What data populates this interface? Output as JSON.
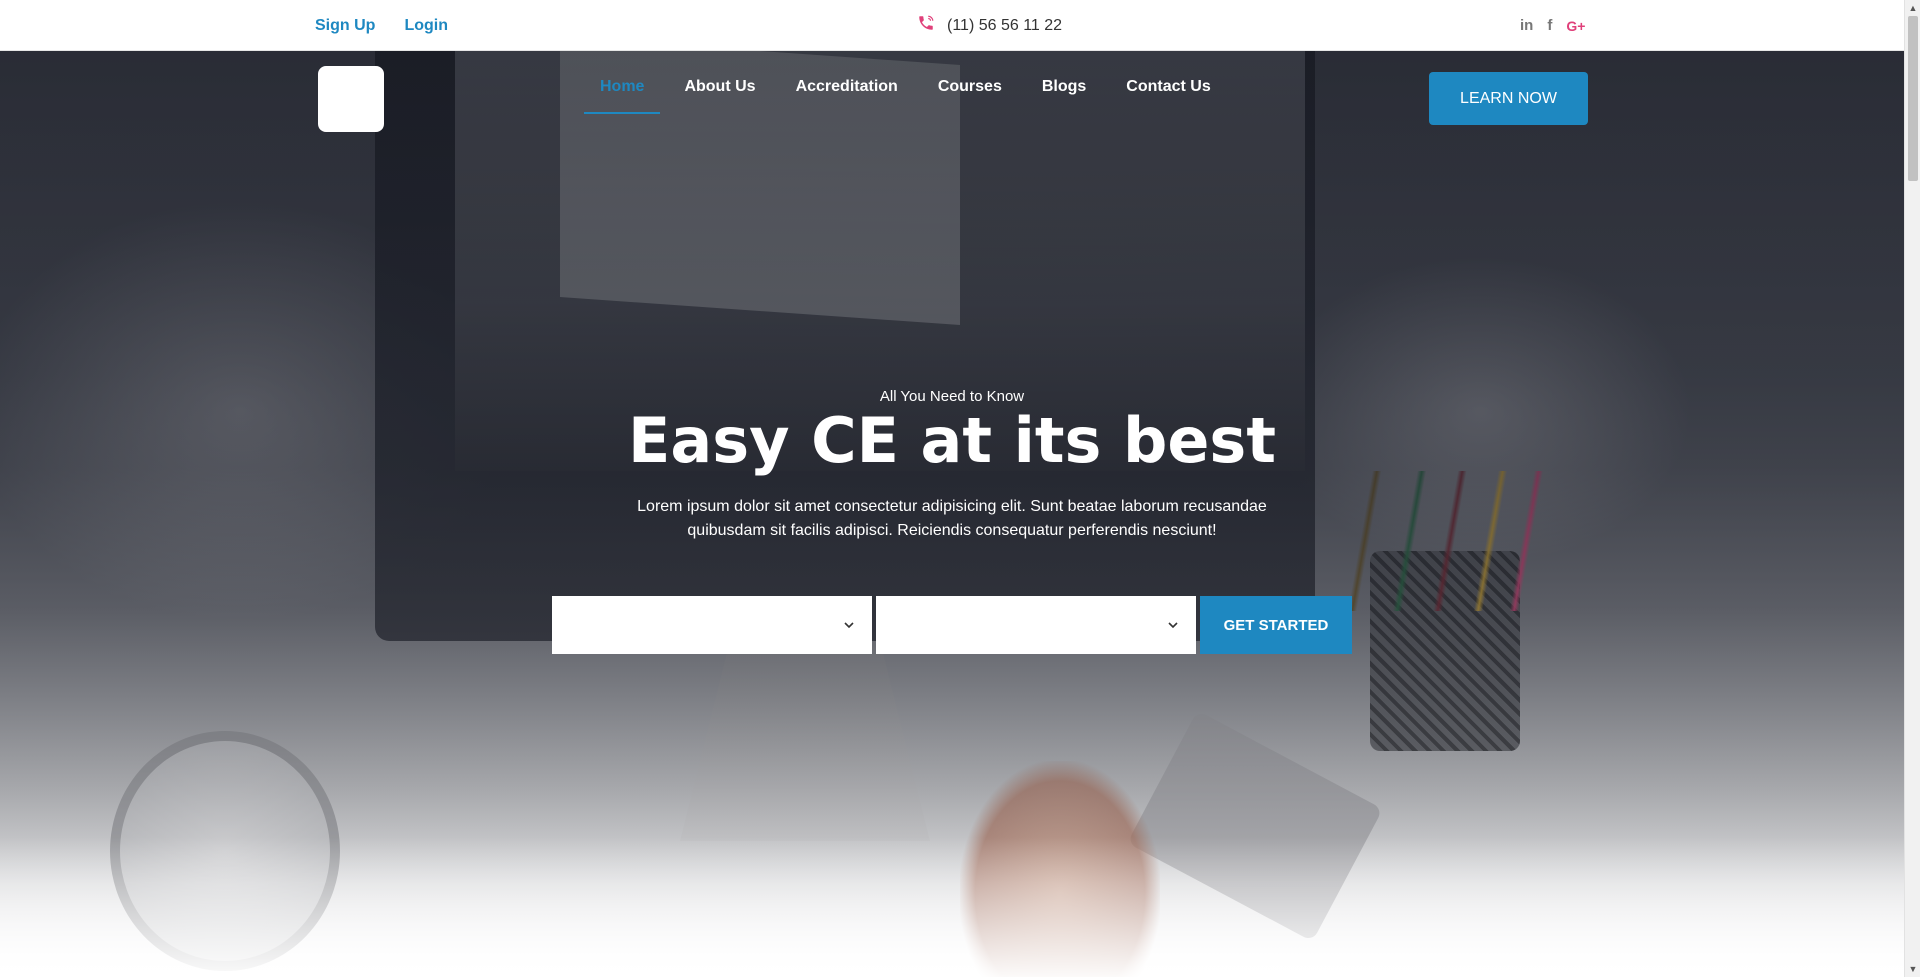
{
  "topbar": {
    "signup_label": "Sign Up",
    "login_label": "Login",
    "phone": "(11) 56 56 11 22",
    "phone_icon": "phone-icon",
    "social_icons": [
      "linkedin-icon",
      "facebook-icon",
      "google-plus-icon"
    ],
    "social_labels": {
      "linkedin": "in",
      "facebook": "f",
      "googleplus": "G+"
    }
  },
  "nav": {
    "items": [
      {
        "label": "Home",
        "active": true
      },
      {
        "label": "About Us",
        "active": false
      },
      {
        "label": "Accreditation",
        "active": false
      },
      {
        "label": "Courses",
        "active": false
      },
      {
        "label": "Blogs",
        "active": false
      },
      {
        "label": "Contact Us",
        "active": false
      }
    ],
    "cta_label": "LEARN NOW"
  },
  "hero": {
    "eyebrow": "All You Need to Know",
    "title": "Easy CE at its best",
    "description": "Lorem ipsum dolor sit amet consectetur adipisicing elit. Sunt beatae laborum recusandae quibusdam sit facilis adipisci. Reiciendis consequatur perferendis nesciunt!"
  },
  "search": {
    "select_1_value": "",
    "select_2_value": "",
    "chevron_icon": "chevron-down-icon",
    "submit_label": "GET STARTED"
  },
  "colors": {
    "accent": "#1e88c1",
    "social_gplus": "#e0407a",
    "phone_icon": "#e0407a"
  }
}
